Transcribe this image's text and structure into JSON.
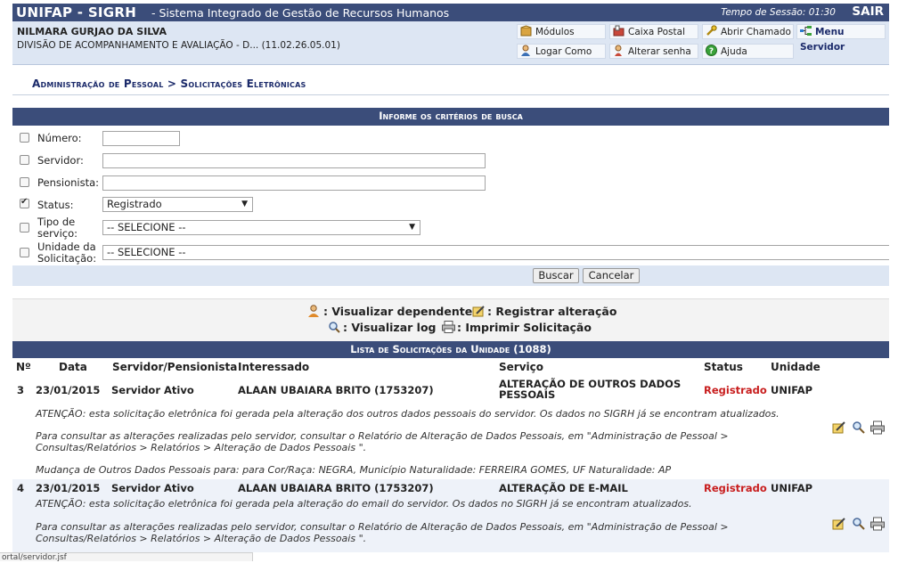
{
  "header": {
    "brand": "UNIFAP - SIGRH",
    "subtitle": "- Sistema Integrado de Gestão de Recursos Humanos",
    "session_label": "Tempo de Sessão: 01:30",
    "logout": "SAIR"
  },
  "user": {
    "name": "NILMARA GURJAO DA SILVA",
    "division": "DIVISÃO DE ACOMPANHAMENTO E AVALIAÇÃO - D... (11.02.26.05.01)"
  },
  "menu": {
    "modulos": "Módulos",
    "caixa_postal": "Caixa Postal",
    "abrir_chamado": "Abrir Chamado",
    "menu_servidor": "Menu Servidor",
    "logar_como": "Logar Como",
    "alterar_senha": "Alterar senha",
    "ajuda": "Ajuda"
  },
  "breadcrumb": "Administração de Pessoal > Solicitações Eletrônicas",
  "search": {
    "title": "Informe os critérios de busca",
    "fields": {
      "numero": {
        "label": "Número:",
        "checked": false,
        "value": ""
      },
      "servidor": {
        "label": "Servidor:",
        "checked": false,
        "value": ""
      },
      "pensionista": {
        "label": "Pensionista:",
        "checked": false,
        "value": ""
      },
      "status": {
        "label": "Status:",
        "checked": true,
        "value": "Registrado"
      },
      "tipo_servico": {
        "label_line1": "Tipo de",
        "label_line2": "serviço:",
        "checked": false,
        "value": "-- SELECIONE --"
      },
      "unidade": {
        "label_line1": "Unidade da",
        "label_line2": "Solicitação:",
        "checked": false,
        "value": "-- SELECIONE --"
      }
    },
    "buttons": {
      "buscar": "Buscar",
      "cancelar": "Cancelar"
    }
  },
  "legend": {
    "visualizar_dependente": ": Visualizar dependente",
    "registrar_alteracao": ": Registrar alteração",
    "visualizar_log": ": Visualizar log",
    "imprimir": ": Imprimir Solicitação"
  },
  "list": {
    "title": "Lista de Solicitações da Unidade (1088)",
    "columns": [
      "Nº",
      "Data",
      "Servidor/Pensionista",
      "Interessado",
      "Serviço",
      "Status",
      "Unidade"
    ],
    "rows": [
      {
        "num": "3",
        "date": "23/01/2015",
        "type": "Servidor Ativo",
        "interested": "ALAAN UBAIARA BRITO (1753207)",
        "service_line1": "ALTERAÇÃO DE OUTROS DADOS",
        "service_line2": "PESSOAIS",
        "status": "Registrado",
        "unit": "UNIFAP",
        "note1": "ATENÇÃO: esta solicitação eletrônica foi gerada pela alteração dos outros dados pessoais do servidor. Os dados no SIGRH já se encontram atualizados.",
        "note2a": "Para consultar as alterações realizadas pelo servidor, consultar o Relatório de Alteração de Dados Pessoais, em \"Administração de Pessoal >",
        "note2b": "Consultas/Relatórios > Relatórios > Alteração de Dados Pessoais \".",
        "note3": "Mudança de Outros Dados Pessoais para: para Cor/Raça: NEGRA, Município Naturalidade: FERREIRA GOMES, UF Naturalidade: AP"
      },
      {
        "num": "4",
        "date": "23/01/2015",
        "type": "Servidor Ativo",
        "interested": "ALAAN UBAIARA BRITO (1753207)",
        "service_line1": "ALTERAÇÃO DE E-MAIL",
        "status": "Registrado",
        "unit": "UNIFAP",
        "note1": "ATENÇÃO: esta solicitação eletrônica foi gerada pela alteração do email do servidor. Os dados no SIGRH já se encontram atualizados.",
        "note2a": "Para consultar as alterações realizadas pelo servidor, consultar o Relatório de Alteração de Dados Pessoais, em \"Administração de Pessoal >",
        "note2b": "Consultas/Relatórios > Relatórios > Alteração de Dados Pessoais \"."
      }
    ]
  },
  "statusbar": "ortal/servidor.jsf"
}
